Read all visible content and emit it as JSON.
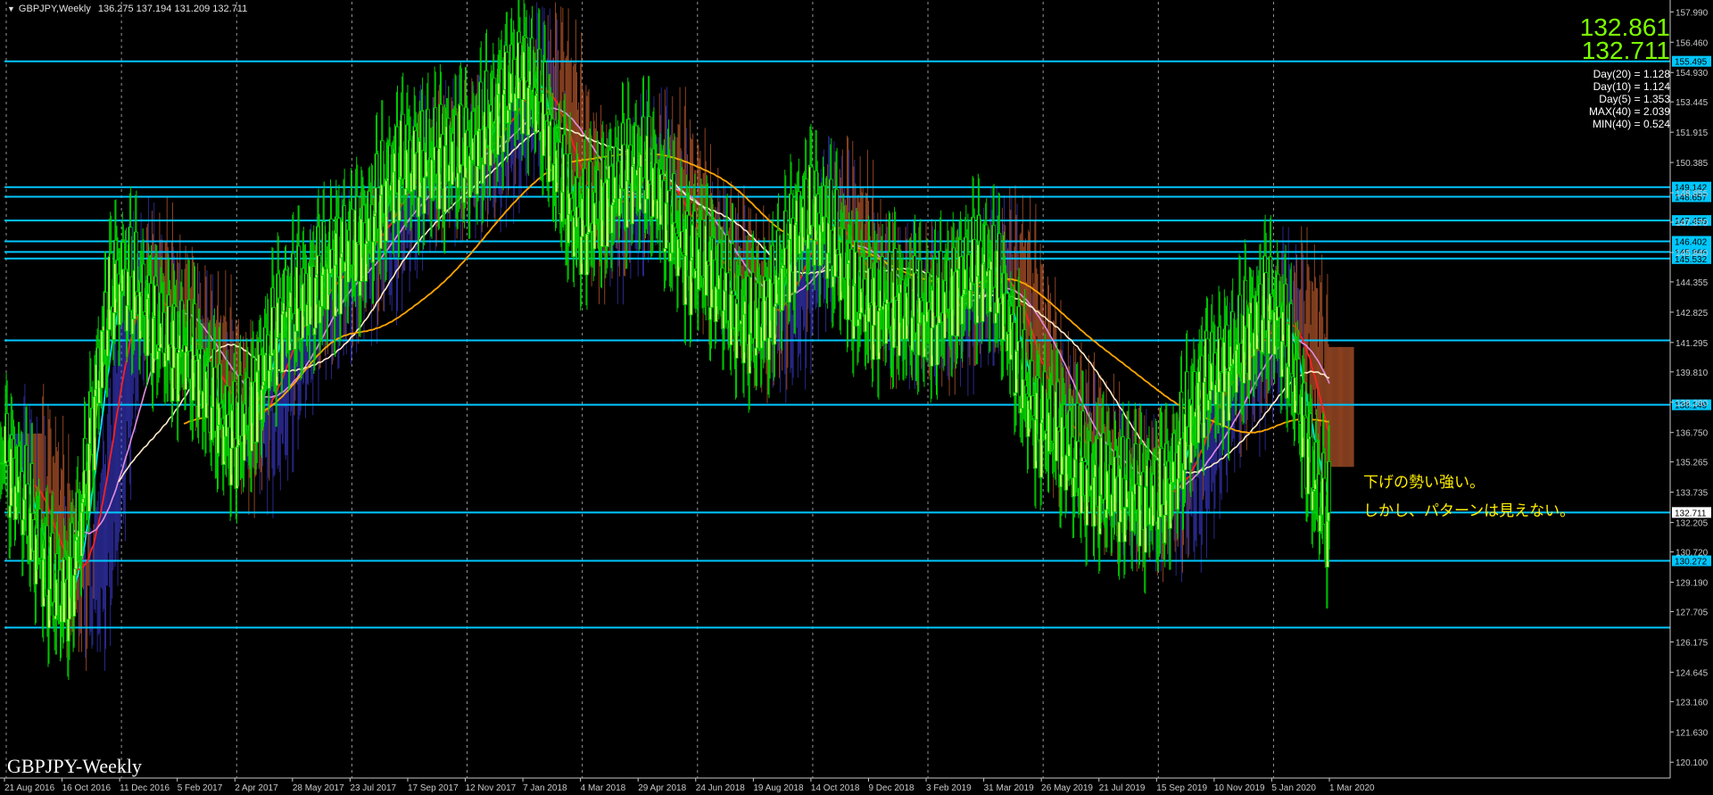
{
  "window": {
    "symbol_title": "GBPJPY,Weekly",
    "ohlc": "136.275 137.194 131.209 132.711",
    "watermark": "GBPJPY-Weekly"
  },
  "price_display": {
    "bid": "132.861",
    "ask": "132.711"
  },
  "stats": [
    "Day(20) = 1.128",
    "Day(10) = 1.124",
    "Day(5) = 1.353",
    "MAX(40) = 2.039",
    "MIN(40) = 0.524"
  ],
  "annotations": {
    "line1": "下げの勢い強い。",
    "line2": "しかし、パターンは見えない。"
  },
  "colors": {
    "background": "#000000",
    "bull_candle": "#ccff66",
    "bear_candle": "#000000",
    "candle_wick": "#00d000",
    "level_line": "#00c8ff",
    "ma_fast": "#ffff00",
    "ma_mid": "#00e5ff",
    "ma_slow": "#ff2020",
    "ma_long": "#ffa500",
    "ma_200": "#ffe9c8",
    "ma_violet": "#e08ee0",
    "price_label_bg": "#00c8ff",
    "current_price_bg": "#ffffff",
    "annotation_text": "#ffee00",
    "big_price": "#7cff00"
  },
  "chart_data": {
    "type": "candlestick",
    "symbol": "GBPJPY",
    "timeframe": "Weekly",
    "ylim": [
      119.3,
      158.5
    ],
    "y_ticks": [
      "157.990",
      "156.460",
      "154.930",
      "153.445",
      "151.915",
      "150.385",
      "148.855",
      "147.370",
      "145.840",
      "144.355",
      "142.825",
      "141.295",
      "139.810",
      "138.280",
      "136.750",
      "135.265",
      "133.735",
      "132.205",
      "130.720",
      "129.190",
      "127.705",
      "126.175",
      "124.645",
      "123.160",
      "121.630",
      "120.100"
    ],
    "x_ticks": [
      "21 Aug 2016",
      "16 Oct 2016",
      "11 Dec 2016",
      "5 Feb 2017",
      "2 Apr 2017",
      "28 May 2017",
      "23 Jul 2017",
      "17 Sep 2017",
      "12 Nov 2017",
      "7 Jan 2018",
      "4 Mar 2018",
      "29 Apr 2018",
      "24 Jun 2018",
      "19 Aug 2018",
      "14 Oct 2018",
      "9 Dec 2018",
      "3 Feb 2019",
      "31 Mar 2019",
      "26 May 2019",
      "21 Jul 2019",
      "15 Sep 2019",
      "10 Nov 2019",
      "5 Jan 2020",
      "1 Mar 2020"
    ],
    "key_closes": [
      {
        "date": "21 Aug 2016",
        "close": 135.2
      },
      {
        "date": "16 Oct 2016",
        "close": 128.6
      },
      {
        "date": "11 Dec 2016",
        "close": 144.5
      },
      {
        "date": "5 Feb 2017",
        "close": 141.2
      },
      {
        "date": "2 Apr 2017",
        "close": 136.8
      },
      {
        "date": "28 May 2017",
        "close": 143.2
      },
      {
        "date": "23 Jul 2017",
        "close": 146.0
      },
      {
        "date": "17 Sep 2017",
        "close": 150.4
      },
      {
        "date": "12 Nov 2017",
        "close": 150.9
      },
      {
        "date": "7 Jan 2018",
        "close": 154.8
      },
      {
        "date": "4 Mar 2018",
        "close": 147.5
      },
      {
        "date": "29 Apr 2018",
        "close": 150.2
      },
      {
        "date": "24 Jun 2018",
        "close": 145.6
      },
      {
        "date": "19 Aug 2018",
        "close": 142.3
      },
      {
        "date": "14 Oct 2018",
        "close": 147.8
      },
      {
        "date": "9 Dec 2018",
        "close": 143.4
      },
      {
        "date": "3 Feb 2019",
        "close": 142.8
      },
      {
        "date": "31 Mar 2019",
        "close": 145.2
      },
      {
        "date": "26 May 2019",
        "close": 137.5
      },
      {
        "date": "21 Jul 2019",
        "close": 134.2
      },
      {
        "date": "15 Sep 2019",
        "close": 133.5
      },
      {
        "date": "10 Nov 2019",
        "close": 139.8
      },
      {
        "date": "5 Jan 2020",
        "close": 143.0
      },
      {
        "date": "1 Mar 2020",
        "close": 132.71
      }
    ],
    "horizontal_levels": [
      {
        "label": "155.495",
        "price": 155.495
      },
      {
        "label": "149.142",
        "price": 149.142
      },
      {
        "label": "148.657",
        "price": 148.657
      },
      {
        "label": "147.455",
        "price": 147.455
      },
      {
        "label": "146.402",
        "price": 146.402
      },
      {
        "label": "145.866",
        "price": 145.866
      },
      {
        "label": "145.532",
        "price": 145.532
      },
      {
        "price": 141.4
      },
      {
        "label": "138.149",
        "price": 138.149
      },
      {
        "label": "132.711",
        "price": 132.711
      },
      {
        "label": "130.272",
        "price": 130.272
      },
      {
        "price": 126.9
      }
    ],
    "grid": true,
    "legend": "none"
  }
}
